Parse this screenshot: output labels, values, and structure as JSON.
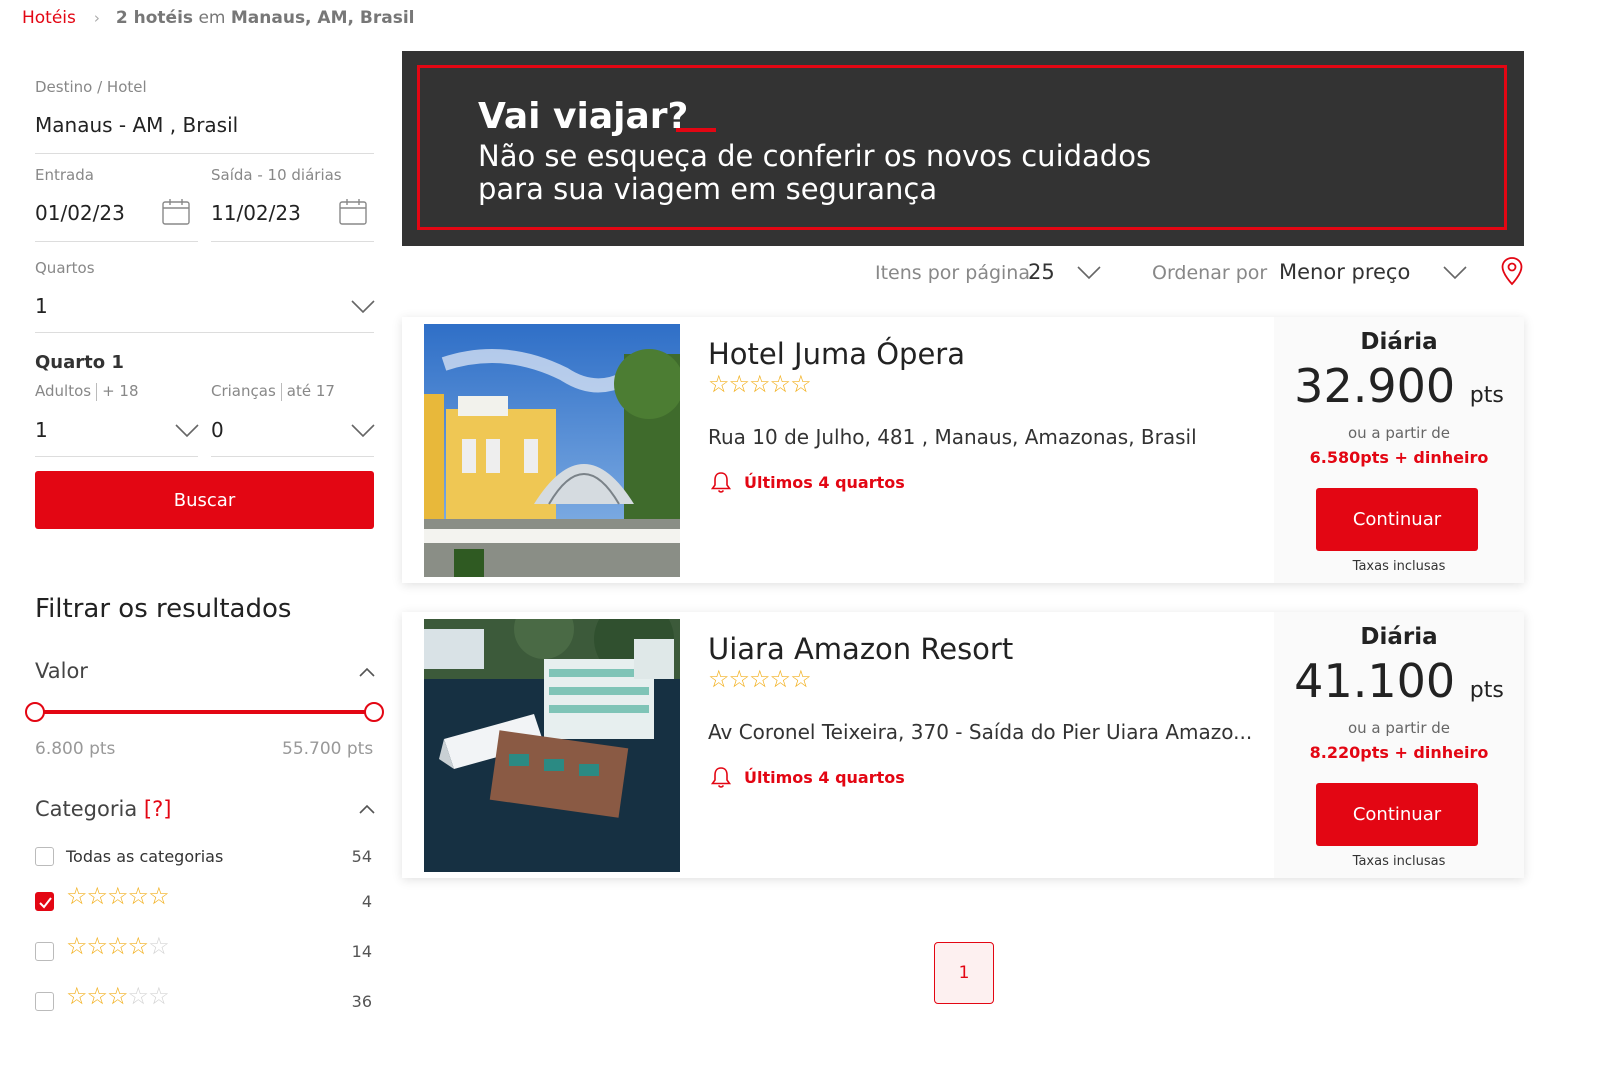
{
  "breadcrumb": {
    "home": "Hotéis",
    "separator": "›",
    "count": "2 hotéis",
    "in": "em",
    "location": "Manaus, AM, Brasil"
  },
  "search": {
    "destination_label": "Destino / Hotel",
    "destination_value": "Manaus - AM , Brasil",
    "checkin_label": "Entrada",
    "checkin_value": "01/02/23",
    "checkout_label": "Saída - 10 diárias",
    "checkout_value": "11/02/23",
    "rooms_label": "Quartos",
    "rooms_value": "1",
    "room_title": "Quarto 1",
    "adults_label": "Adultos",
    "adults_hint": "+ 18",
    "adults_value": "1",
    "children_label": "Crianças",
    "children_hint": "até 17",
    "children_value": "0",
    "search_button": "Buscar"
  },
  "filters": {
    "title": "Filtrar os resultados",
    "value_section": "Valor",
    "range_min": "6.800 pts",
    "range_max": "55.700 pts",
    "category_section": "Categoria",
    "category_help": "[?]",
    "options": [
      {
        "label": "Todas as categorias",
        "count": "54",
        "checked": false,
        "stars": 0
      },
      {
        "label": "",
        "count": "4",
        "checked": true,
        "stars": 5
      },
      {
        "label": "",
        "count": "14",
        "checked": false,
        "stars": 4
      },
      {
        "label": "",
        "count": "36",
        "checked": false,
        "stars": 3
      }
    ]
  },
  "banner": {
    "title": "Vai viajar?",
    "line1": "Não se esqueça de conferir os novos cuidados",
    "line2": "para sua viagem em segurança"
  },
  "sort": {
    "per_page_label": "Itens por página",
    "per_page_value": "25",
    "order_label": "Ordenar por",
    "order_value": "Menor preço"
  },
  "hotels": [
    {
      "name": "Hotel Juma Ópera",
      "address": "Rua 10 de Julho, 481 , Manaus, Amazonas, Brasil",
      "alert": "Últimos 4 quartos",
      "price_label": "Diária",
      "points": "32.900",
      "points_unit": "pts",
      "or_from": "ou a partir de",
      "cash_option": "6.580pts + dinheiro",
      "button": "Continuar",
      "taxes": "Taxas inclusas"
    },
    {
      "name": "Uiara Amazon Resort",
      "address": "Av Coronel Teixeira, 370 - Saída do Pier Uiara Amazo...",
      "alert": "Últimos 4 quartos",
      "price_label": "Diária",
      "points": "41.100",
      "points_unit": "pts",
      "or_from": "ou a partir de",
      "cash_option": "8.220pts + dinheiro",
      "button": "Continuar",
      "taxes": "Taxas inclusas"
    }
  ],
  "pagination": {
    "current": "1"
  },
  "icons": {
    "calendar": "calendar-icon",
    "chevron": "chevron-down-icon",
    "map_pin": "map-pin-icon",
    "bell": "bell-icon",
    "star": "star-icon"
  },
  "colors": {
    "accent": "#e30613",
    "banner_bg": "#333333",
    "star": "#f2b01e"
  }
}
